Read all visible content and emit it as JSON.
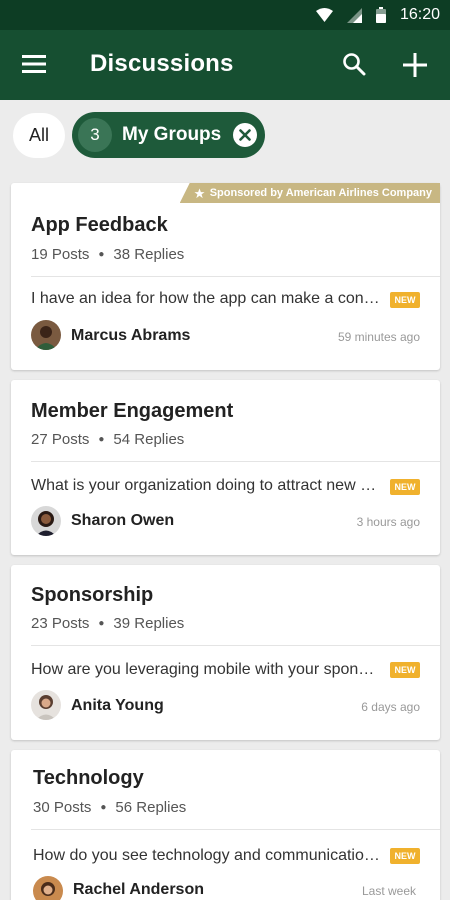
{
  "status": {
    "time": "16:20"
  },
  "appbar": {
    "title": "Discussions"
  },
  "filters": {
    "all_label": "All",
    "groups_count": "3",
    "groups_label": "My Groups"
  },
  "colors": {
    "primary": "#164f31",
    "status": "#0d3d24",
    "chip": "#1e5a3a",
    "badge": "#f0b12d",
    "sponsor": "#c8b783"
  },
  "cards": [
    {
      "title": "App Feedback",
      "posts": "19 Posts",
      "replies": "38 Replies",
      "sponsor": "Sponsored by American Airlines Company",
      "preview": "I have an idea for how the app can make a connection with members",
      "badge": "NEW",
      "author": "Marcus Abrams",
      "time": "59 minutes ago"
    },
    {
      "title": "Member Engagement",
      "posts": "27 Posts",
      "replies": "54 Replies",
      "preview": "What is your organization doing to attract new members",
      "badge": "NEW",
      "author": "Sharon Owen",
      "time": "3 hours ago"
    },
    {
      "title": "Sponsorship",
      "posts": "23 Posts",
      "replies": "39 Replies",
      "preview": "How are you leveraging mobile with your sponsors",
      "badge": "NEW",
      "author": "Anita Young",
      "time": "6 days ago"
    },
    {
      "title": "Technology",
      "posts": "30 Posts",
      "replies": "56 Replies",
      "preview": "How do you see technology and communication changing",
      "badge": "NEW",
      "author": "Rachel Anderson",
      "time": "Last week"
    }
  ]
}
